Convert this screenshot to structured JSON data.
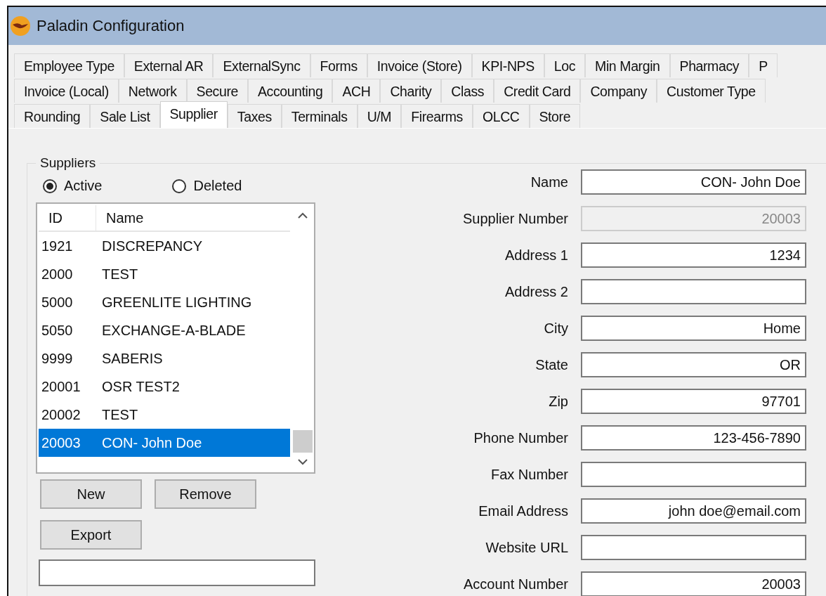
{
  "window": {
    "title": "Paladin Configuration"
  },
  "tab_rows": [
    [
      {
        "label": "Employee Type",
        "selected": false
      },
      {
        "label": "External AR",
        "selected": false
      },
      {
        "label": "ExternalSync",
        "selected": false
      },
      {
        "label": "Forms",
        "selected": false
      },
      {
        "label": "Invoice (Store)",
        "selected": false
      },
      {
        "label": "KPI-NPS",
        "selected": false
      },
      {
        "label": "Loc",
        "selected": false
      },
      {
        "label": "Min Margin",
        "selected": false
      },
      {
        "label": "Pharmacy",
        "selected": false
      },
      {
        "label": "P",
        "selected": false
      }
    ],
    [
      {
        "label": "Invoice (Local)",
        "selected": false
      },
      {
        "label": "Network",
        "selected": false
      },
      {
        "label": "Secure",
        "selected": false
      },
      {
        "label": "Accounting",
        "selected": false
      },
      {
        "label": "ACH",
        "selected": false
      },
      {
        "label": "Charity",
        "selected": false
      },
      {
        "label": "Class",
        "selected": false
      },
      {
        "label": "Credit Card",
        "selected": false
      },
      {
        "label": "Company",
        "selected": false
      },
      {
        "label": "Customer Type",
        "selected": false
      }
    ],
    [
      {
        "label": "Rounding",
        "selected": false
      },
      {
        "label": "Sale List",
        "selected": false
      },
      {
        "label": "Supplier",
        "selected": true
      },
      {
        "label": "Taxes",
        "selected": false
      },
      {
        "label": "Terminals",
        "selected": false
      },
      {
        "label": "U/M",
        "selected": false
      },
      {
        "label": "Firearms",
        "selected": false
      },
      {
        "label": "OLCC",
        "selected": false
      },
      {
        "label": "Store",
        "selected": false
      }
    ]
  ],
  "suppliers": {
    "title": "Suppliers",
    "filters": [
      {
        "label": "Active",
        "selected": true
      },
      {
        "label": "Deleted",
        "selected": false
      }
    ],
    "list": {
      "columns": [
        "ID",
        "Name"
      ],
      "rows": [
        {
          "id": "1921",
          "name": "DISCREPANCY",
          "selected": false
        },
        {
          "id": "2000",
          "name": "TEST",
          "selected": false
        },
        {
          "id": "5000",
          "name": "GREENLITE LIGHTING",
          "selected": false
        },
        {
          "id": "5050",
          "name": "EXCHANGE-A-BLADE",
          "selected": false
        },
        {
          "id": "9999",
          "name": "SABERIS",
          "selected": false
        },
        {
          "id": "20001",
          "name": "OSR TEST2",
          "selected": false
        },
        {
          "id": "20002",
          "name": "TEST",
          "selected": false
        },
        {
          "id": "20003",
          "name": "CON- John Doe",
          "selected": true
        }
      ]
    },
    "buttons": [
      "New",
      "Remove",
      "Export"
    ]
  },
  "form": {
    "fields": [
      {
        "label": "Name",
        "value": "CON- John Doe",
        "disabled": false
      },
      {
        "label": "Supplier Number",
        "value": "20003",
        "disabled": true
      },
      {
        "label": "Address 1",
        "value": "1234",
        "disabled": false
      },
      {
        "label": "Address 2",
        "disabled": false
      },
      {
        "label": "City",
        "value": "Home",
        "disabled": false
      },
      {
        "label": "State",
        "value": "OR",
        "disabled": false
      },
      {
        "label": "Zip",
        "value": "97701",
        "disabled": false
      },
      {
        "label": "Phone Number",
        "value": "123-456-7890",
        "disabled": false
      },
      {
        "label": "Fax Number",
        "disabled": false
      },
      {
        "label": "Email Address",
        "value": "john doe@email.com",
        "disabled": false
      },
      {
        "label": "Website URL",
        "disabled": false
      },
      {
        "label": "Account Number",
        "value": "20003",
        "disabled": false
      }
    ]
  }
}
